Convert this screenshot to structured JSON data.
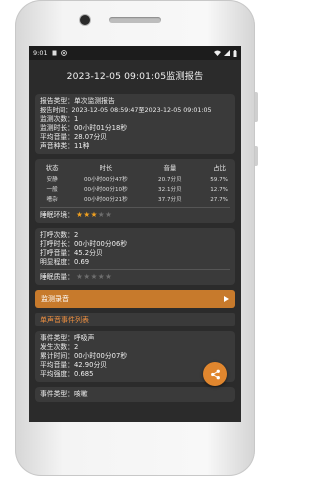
{
  "status_bar": {
    "time": "9:01",
    "left_icons": [
      "sim-icon",
      "record-icon"
    ],
    "right_icons": [
      "wifi-icon",
      "signal-icon",
      "battery-icon"
    ]
  },
  "app_bar": {
    "title": "2023-12-05 09:01:05监测报告"
  },
  "report": {
    "type": "报告类型：单次监测报告",
    "time": "报告时间：2023-12-05 08:59:47至2023-12-05 09:01:05",
    "count": "监测次数：1",
    "duration": "监测时长：00小时01分18秒",
    "avg_volume": "平均音量：28.07分贝",
    "sound_types": "声音种类：11种"
  },
  "state_table": {
    "headers": [
      "状态",
      "时长",
      "音量",
      "占比"
    ],
    "rows": [
      [
        "安静",
        "00小时00分47秒",
        "20.7分贝",
        "59.7%"
      ],
      [
        "一般",
        "00小时00分10秒",
        "32.1分贝",
        "12.7%"
      ],
      [
        "嘈杂",
        "00小时00分21秒",
        "37.7分贝",
        "27.7%"
      ]
    ],
    "sleep_env_label": "睡眠环境：",
    "sleep_env_rating": 3,
    "sleep_env_max": 5
  },
  "snore": {
    "count": "打呼次数：2",
    "duration": "打呼时长：00小时00分06秒",
    "volume": "打呼音量：45.2分贝",
    "intensity": "明显程度：0.69",
    "sleep_quality_label": "睡眠质量：",
    "sleep_quality_rating": 0,
    "sleep_quality_max": 5
  },
  "buttons": {
    "monitor_recording": "监测录音"
  },
  "section": {
    "single_event_list": "单声音事件列表"
  },
  "events": [
    {
      "type": "事件类型：呼吸声",
      "count": "发生次数：2",
      "total_time": "累计时间：00小时00分07秒",
      "avg_volume": "平均音量：42.90分贝",
      "avg_intensity": "平均强度：0.685"
    },
    {
      "type": "事件类型：咳嗽"
    }
  ],
  "colors": {
    "accent": "#c77a2c",
    "fab": "#e0862e",
    "section_text": "#f09040",
    "star_on": "#f0a020",
    "card": "#3a3a3a",
    "background": "#2b2b2b"
  }
}
